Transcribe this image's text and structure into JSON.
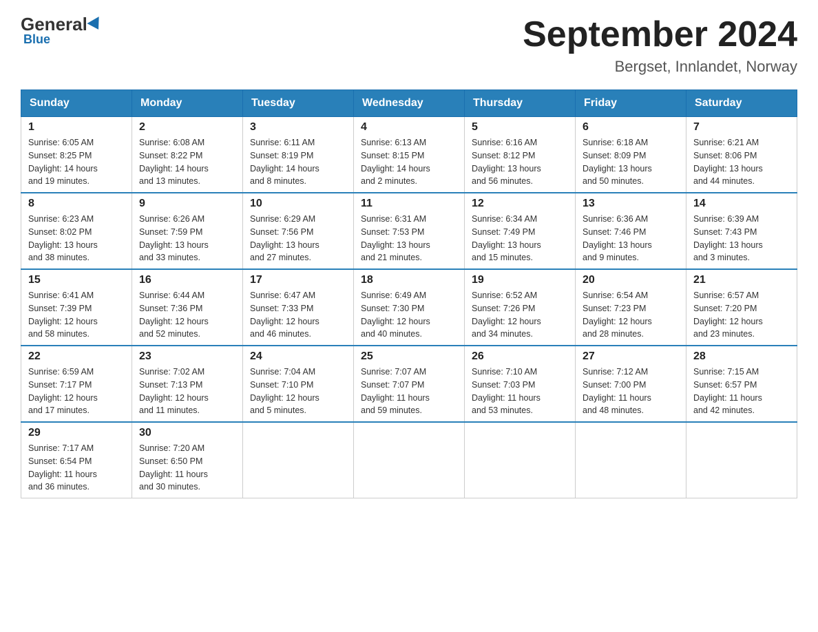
{
  "logo": {
    "general": "General",
    "blue": "Blue"
  },
  "header": {
    "title": "September 2024",
    "location": "Bergset, Innlandet, Norway"
  },
  "weekdays": [
    "Sunday",
    "Monday",
    "Tuesday",
    "Wednesday",
    "Thursday",
    "Friday",
    "Saturday"
  ],
  "weeks": [
    [
      {
        "day": "1",
        "sunrise": "6:05 AM",
        "sunset": "8:25 PM",
        "daylight": "14 hours and 19 minutes."
      },
      {
        "day": "2",
        "sunrise": "6:08 AM",
        "sunset": "8:22 PM",
        "daylight": "14 hours and 13 minutes."
      },
      {
        "day": "3",
        "sunrise": "6:11 AM",
        "sunset": "8:19 PM",
        "daylight": "14 hours and 8 minutes."
      },
      {
        "day": "4",
        "sunrise": "6:13 AM",
        "sunset": "8:15 PM",
        "daylight": "14 hours and 2 minutes."
      },
      {
        "day": "5",
        "sunrise": "6:16 AM",
        "sunset": "8:12 PM",
        "daylight": "13 hours and 56 minutes."
      },
      {
        "day": "6",
        "sunrise": "6:18 AM",
        "sunset": "8:09 PM",
        "daylight": "13 hours and 50 minutes."
      },
      {
        "day": "7",
        "sunrise": "6:21 AM",
        "sunset": "8:06 PM",
        "daylight": "13 hours and 44 minutes."
      }
    ],
    [
      {
        "day": "8",
        "sunrise": "6:23 AM",
        "sunset": "8:02 PM",
        "daylight": "13 hours and 38 minutes."
      },
      {
        "day": "9",
        "sunrise": "6:26 AM",
        "sunset": "7:59 PM",
        "daylight": "13 hours and 33 minutes."
      },
      {
        "day": "10",
        "sunrise": "6:29 AM",
        "sunset": "7:56 PM",
        "daylight": "13 hours and 27 minutes."
      },
      {
        "day": "11",
        "sunrise": "6:31 AM",
        "sunset": "7:53 PM",
        "daylight": "13 hours and 21 minutes."
      },
      {
        "day": "12",
        "sunrise": "6:34 AM",
        "sunset": "7:49 PM",
        "daylight": "13 hours and 15 minutes."
      },
      {
        "day": "13",
        "sunrise": "6:36 AM",
        "sunset": "7:46 PM",
        "daylight": "13 hours and 9 minutes."
      },
      {
        "day": "14",
        "sunrise": "6:39 AM",
        "sunset": "7:43 PM",
        "daylight": "13 hours and 3 minutes."
      }
    ],
    [
      {
        "day": "15",
        "sunrise": "6:41 AM",
        "sunset": "7:39 PM",
        "daylight": "12 hours and 58 minutes."
      },
      {
        "day": "16",
        "sunrise": "6:44 AM",
        "sunset": "7:36 PM",
        "daylight": "12 hours and 52 minutes."
      },
      {
        "day": "17",
        "sunrise": "6:47 AM",
        "sunset": "7:33 PM",
        "daylight": "12 hours and 46 minutes."
      },
      {
        "day": "18",
        "sunrise": "6:49 AM",
        "sunset": "7:30 PM",
        "daylight": "12 hours and 40 minutes."
      },
      {
        "day": "19",
        "sunrise": "6:52 AM",
        "sunset": "7:26 PM",
        "daylight": "12 hours and 34 minutes."
      },
      {
        "day": "20",
        "sunrise": "6:54 AM",
        "sunset": "7:23 PM",
        "daylight": "12 hours and 28 minutes."
      },
      {
        "day": "21",
        "sunrise": "6:57 AM",
        "sunset": "7:20 PM",
        "daylight": "12 hours and 23 minutes."
      }
    ],
    [
      {
        "day": "22",
        "sunrise": "6:59 AM",
        "sunset": "7:17 PM",
        "daylight": "12 hours and 17 minutes."
      },
      {
        "day": "23",
        "sunrise": "7:02 AM",
        "sunset": "7:13 PM",
        "daylight": "12 hours and 11 minutes."
      },
      {
        "day": "24",
        "sunrise": "7:04 AM",
        "sunset": "7:10 PM",
        "daylight": "12 hours and 5 minutes."
      },
      {
        "day": "25",
        "sunrise": "7:07 AM",
        "sunset": "7:07 PM",
        "daylight": "11 hours and 59 minutes."
      },
      {
        "day": "26",
        "sunrise": "7:10 AM",
        "sunset": "7:03 PM",
        "daylight": "11 hours and 53 minutes."
      },
      {
        "day": "27",
        "sunrise": "7:12 AM",
        "sunset": "7:00 PM",
        "daylight": "11 hours and 48 minutes."
      },
      {
        "day": "28",
        "sunrise": "7:15 AM",
        "sunset": "6:57 PM",
        "daylight": "11 hours and 42 minutes."
      }
    ],
    [
      {
        "day": "29",
        "sunrise": "7:17 AM",
        "sunset": "6:54 PM",
        "daylight": "11 hours and 36 minutes."
      },
      {
        "day": "30",
        "sunrise": "7:20 AM",
        "sunset": "6:50 PM",
        "daylight": "11 hours and 30 minutes."
      },
      null,
      null,
      null,
      null,
      null
    ]
  ],
  "labels": {
    "sunrise": "Sunrise:",
    "sunset": "Sunset:",
    "daylight": "Daylight:"
  }
}
